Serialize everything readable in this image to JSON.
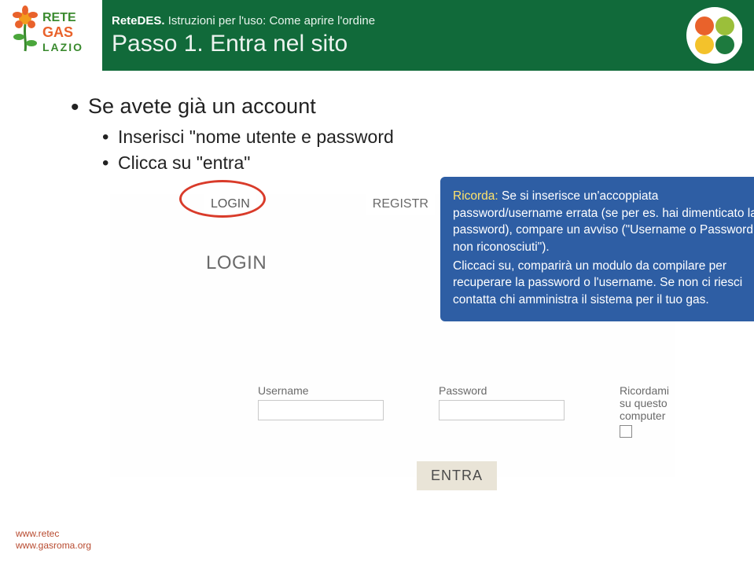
{
  "header": {
    "brand": "ReteDES.",
    "breadcrumb_rest": " Istruzioni per l'uso: Come aprire l'ordine",
    "title": "Passo 1. Entra nel sito"
  },
  "content": {
    "b1": "Se avete già un account",
    "b2a": "Inserisci \"nome utente e password",
    "b2b": "Clicca su \"entra\""
  },
  "tabs": {
    "login": "LOGIN",
    "registr": "REGISTR"
  },
  "note": {
    "ricorda_label": "Ricorda:",
    "text1": " Se si inserisce un'accoppiata password/username errata (se per es. hai dimenticato la password), compare un avviso (\"Username o Password non riconosciuti\").",
    "text2": "Cliccaci su, comparirà un modulo da compilare per recuperare la password o l'username. Se non ci riesci contatta chi amministra il sistema per il tuo gas."
  },
  "form": {
    "heading": "LOGIN",
    "username_label": "Username",
    "password_label": "Password",
    "remember_label": "Ricordami su questo computer",
    "button_label": "ENTRA"
  },
  "footer": {
    "line1": "www.retec",
    "line2": "www.gasroma.org"
  },
  "colors": {
    "header_bg": "#116a3a",
    "note_bg": "#2e5ea4",
    "highlight": "#ffe36a",
    "oval": "#d93b2a"
  }
}
